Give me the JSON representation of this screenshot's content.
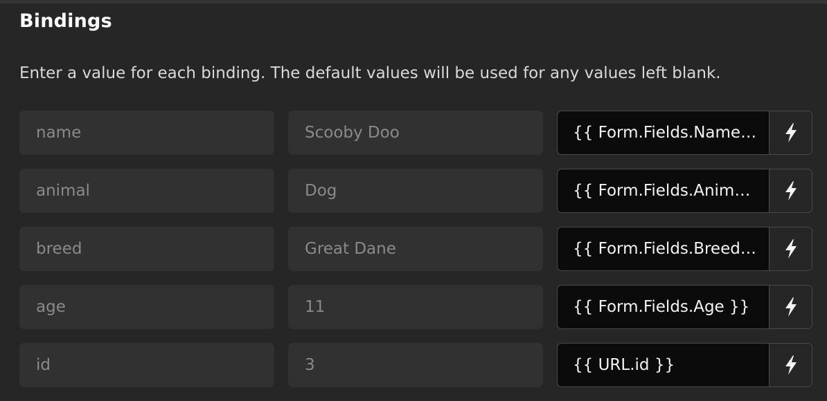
{
  "section": {
    "title": "Bindings",
    "description": "Enter a value for each binding. The default values will be used for any values left blank."
  },
  "bindings": [
    {
      "name": "name",
      "default": "Scooby Doo",
      "value": "{{ Form.Fields.Name }}"
    },
    {
      "name": "animal",
      "default": "Dog",
      "value": "{{ Form.Fields.Anim…"
    },
    {
      "name": "breed",
      "default": "Great Dane",
      "value": "{{ Form.Fields.Breed }}"
    },
    {
      "name": "age",
      "default": "11",
      "value": "{{ Form.Fields.Age }}"
    },
    {
      "name": "id",
      "default": "3",
      "value": "{{ URL.id }}"
    }
  ],
  "icons": {
    "binding_button": "lightning-bolt-icon"
  },
  "colors": {
    "background": "#262626",
    "field_background": "#313131",
    "binding_background": "#0b0b0b",
    "border": "#4a4a4a"
  }
}
